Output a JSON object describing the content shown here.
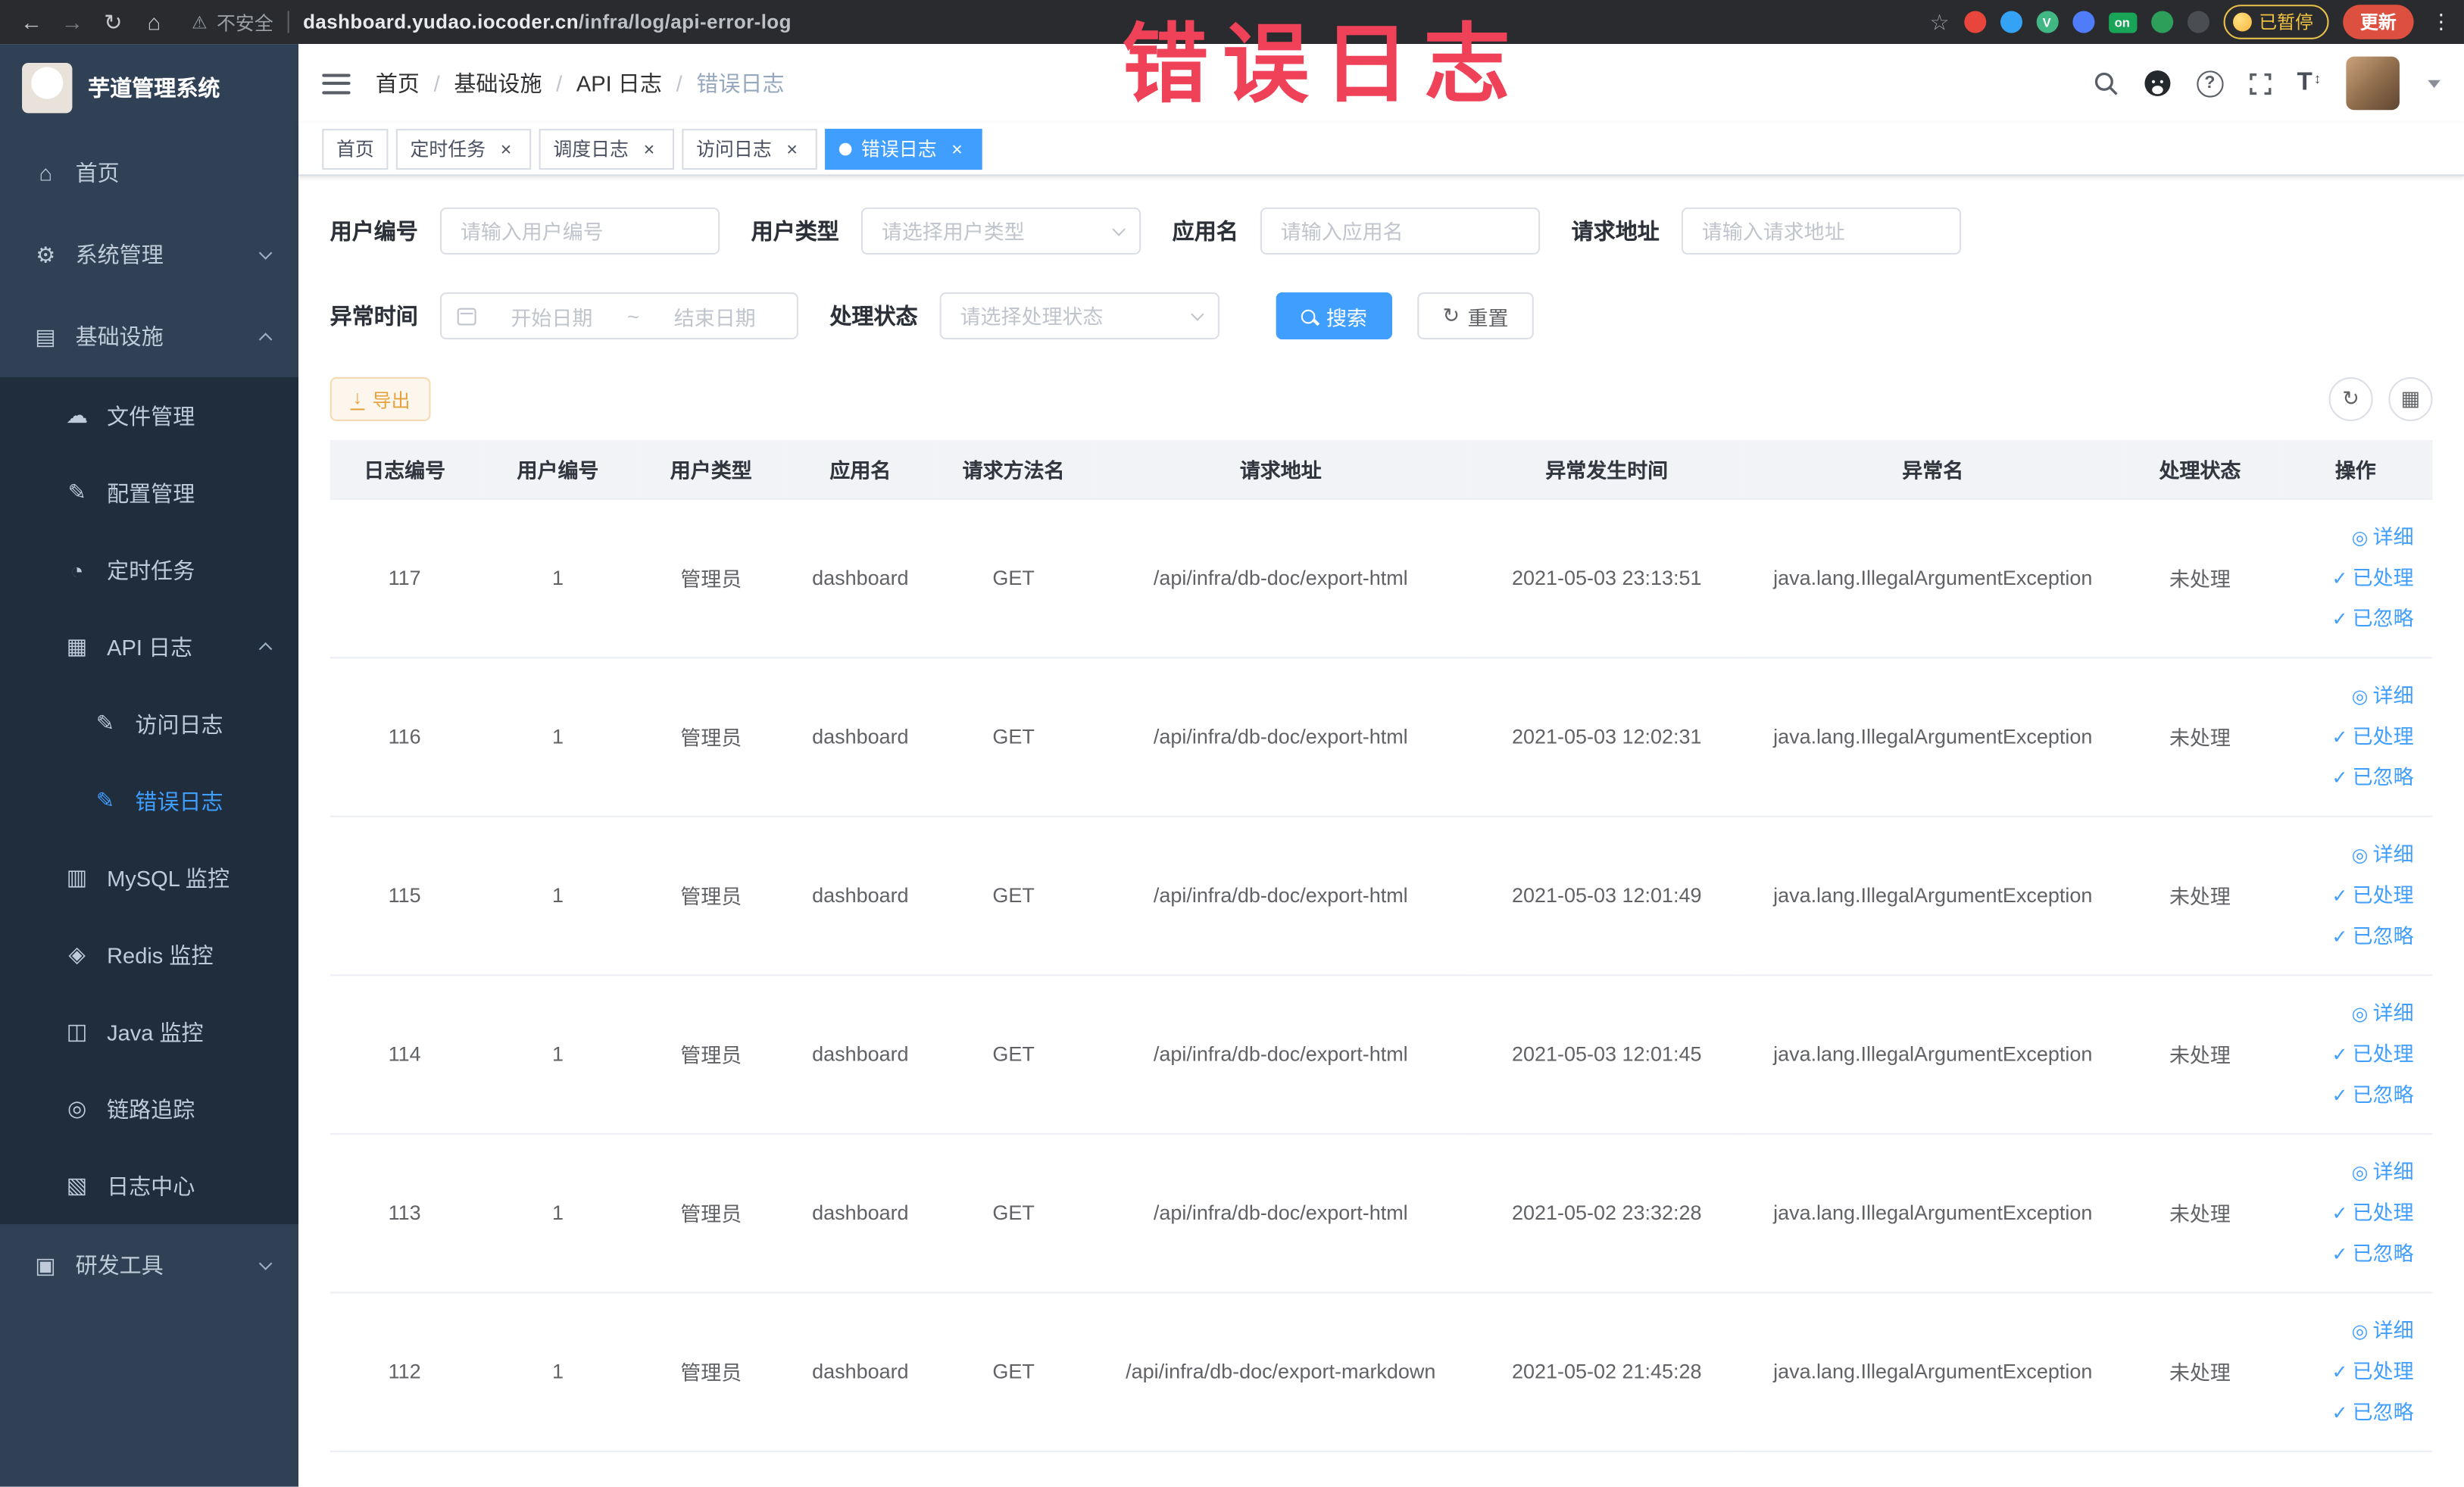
{
  "watermark": "错误日志",
  "browser": {
    "security_label": "不安全",
    "url_domain": "dashboard.yudao.iocoder.cn",
    "url_path": "/infra/log/api-error-log",
    "extension_on_badge": "on",
    "paused_badge": "已暂停",
    "update_button": "更新"
  },
  "sidebar": {
    "app_title": "芋道管理系统",
    "menu": [
      "首页",
      "系统管理",
      "基础设施",
      "文件管理",
      "配置管理",
      "定时任务",
      "API 日志",
      "访问日志",
      "错误日志",
      "MySQL 监控",
      "Redis 监控",
      "Java 监控",
      "链路追踪",
      "日志中心",
      "研发工具"
    ]
  },
  "breadcrumb": {
    "separator": "/",
    "items": [
      "首页",
      "基础设施",
      "API 日志",
      "错误日志"
    ]
  },
  "tags": [
    "首页",
    "定时任务",
    "调度日志",
    "访问日志",
    "错误日志"
  ],
  "filters": {
    "user_id": {
      "label": "用户编号",
      "placeholder": "请输入用户编号"
    },
    "user_type": {
      "label": "用户类型",
      "placeholder": "请选择用户类型"
    },
    "app_name": {
      "label": "应用名",
      "placeholder": "请输入应用名"
    },
    "request_url": {
      "label": "请求地址",
      "placeholder": "请输入请求地址"
    },
    "exception_time": {
      "label": "异常时间",
      "start_placeholder": "开始日期",
      "separator": "~",
      "end_placeholder": "结束日期"
    },
    "process_status": {
      "label": "处理状态",
      "placeholder": "请选择处理状态"
    },
    "search_button": "搜索",
    "reset_button": "重置"
  },
  "toolbar": {
    "export_button": "导出"
  },
  "table": {
    "columns": [
      "日志编号",
      "用户编号",
      "用户类型",
      "应用名",
      "请求方法名",
      "请求地址",
      "异常发生时间",
      "异常名",
      "处理状态",
      "操作"
    ],
    "actions": {
      "detail": "详细",
      "processed": "已处理",
      "ignored": "已忽略"
    },
    "rows": [
      {
        "log_id": "117",
        "user_id": "1",
        "user_type": "管理员",
        "app_name": "dashboard",
        "method": "GET",
        "request_url": "/api/infra/db-doc/export-html",
        "exception_time": "2021-05-03 23:13:51",
        "exception_name": "java.lang.IllegalArgumentException",
        "status": "未处理"
      },
      {
        "log_id": "116",
        "user_id": "1",
        "user_type": "管理员",
        "app_name": "dashboard",
        "method": "GET",
        "request_url": "/api/infra/db-doc/export-html",
        "exception_time": "2021-05-03 12:02:31",
        "exception_name": "java.lang.IllegalArgumentException",
        "status": "未处理"
      },
      {
        "log_id": "115",
        "user_id": "1",
        "user_type": "管理员",
        "app_name": "dashboard",
        "method": "GET",
        "request_url": "/api/infra/db-doc/export-html",
        "exception_time": "2021-05-03 12:01:49",
        "exception_name": "java.lang.IllegalArgumentException",
        "status": "未处理"
      },
      {
        "log_id": "114",
        "user_id": "1",
        "user_type": "管理员",
        "app_name": "dashboard",
        "method": "GET",
        "request_url": "/api/infra/db-doc/export-html",
        "exception_time": "2021-05-03 12:01:45",
        "exception_name": "java.lang.IllegalArgumentException",
        "status": "未处理"
      },
      {
        "log_id": "113",
        "user_id": "1",
        "user_type": "管理员",
        "app_name": "dashboard",
        "method": "GET",
        "request_url": "/api/infra/db-doc/export-html",
        "exception_time": "2021-05-02 23:32:28",
        "exception_name": "java.lang.IllegalArgumentException",
        "status": "未处理"
      },
      {
        "log_id": "112",
        "user_id": "1",
        "user_type": "管理员",
        "app_name": "dashboard",
        "method": "GET",
        "request_url": "/api/infra/db-doc/export-markdown",
        "exception_time": "2021-05-02 21:45:28",
        "exception_name": "java.lang.IllegalArgumentException",
        "status": "未处理"
      }
    ]
  }
}
